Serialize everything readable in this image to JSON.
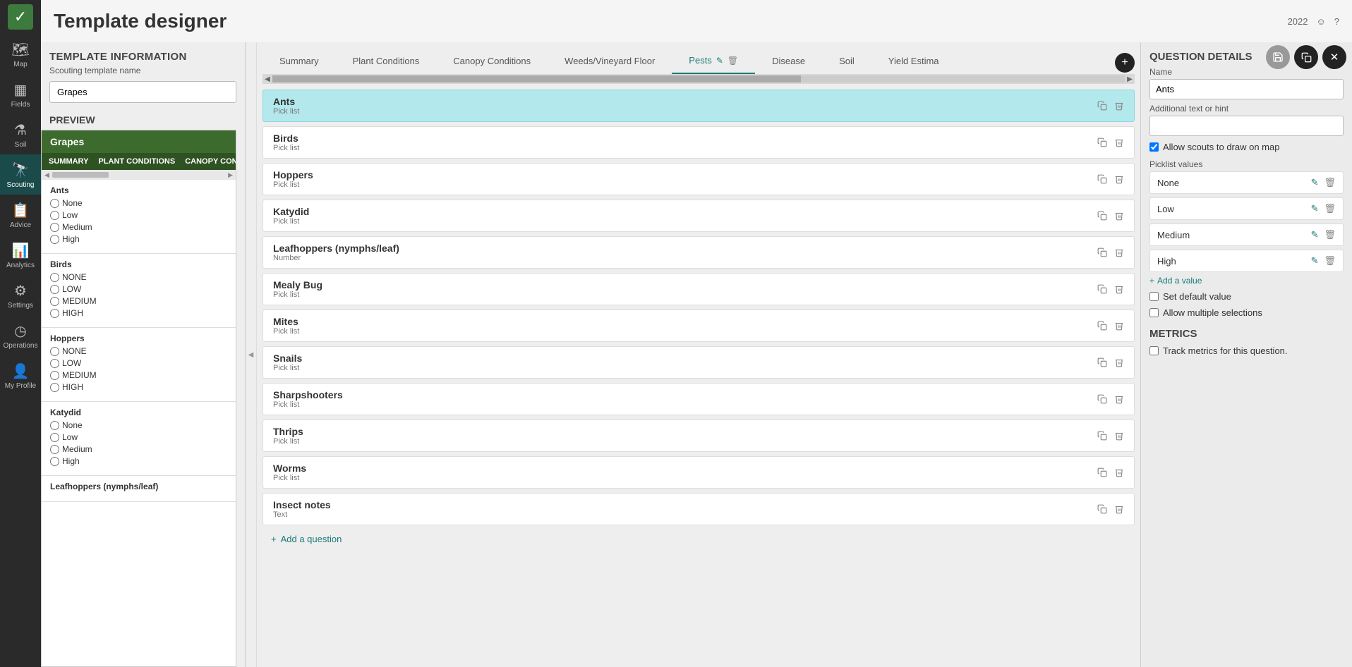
{
  "header": {
    "title": "Template designer",
    "year": "2022"
  },
  "nav": {
    "items": [
      {
        "label": "Map",
        "icon": "map"
      },
      {
        "label": "Fields",
        "icon": "fields"
      },
      {
        "label": "Soil",
        "icon": "flask"
      },
      {
        "label": "Scouting",
        "icon": "binoculars",
        "active": true
      },
      {
        "label": "Advice",
        "icon": "clipboard"
      },
      {
        "label": "Analytics",
        "icon": "chart"
      },
      {
        "label": "Settings",
        "icon": "gear"
      },
      {
        "label": "Operations",
        "icon": "gauge"
      },
      {
        "label": "My Profile",
        "icon": "user"
      }
    ]
  },
  "templateInfo": {
    "heading": "TEMPLATE INFORMATION",
    "nameLabel": "Scouting template name",
    "nameValue": "Grapes",
    "previewHeading": "PREVIEW"
  },
  "preview": {
    "title": "Grapes",
    "tabs": [
      "SUMMARY",
      "PLANT CONDITIONS",
      "CANOPY CON"
    ],
    "questions": [
      {
        "title": "Ants",
        "options": [
          "None",
          "Low",
          "Medium",
          "High"
        ]
      },
      {
        "title": "Birds",
        "options": [
          "NONE",
          "LOW",
          "MEDIUM",
          "HIGH"
        ]
      },
      {
        "title": "Hoppers",
        "options": [
          "NONE",
          "LOW",
          "MEDIUM",
          "HIGH"
        ]
      },
      {
        "title": "Katydid",
        "options": [
          "None",
          "Low",
          "Medium",
          "High"
        ]
      },
      {
        "title": "Leafhoppers (nymphs/leaf)",
        "options": []
      }
    ]
  },
  "centerTabs": {
    "tabs": [
      {
        "label": "Summary"
      },
      {
        "label": "Plant Conditions"
      },
      {
        "label": "Canopy Conditions"
      },
      {
        "label": "Weeds/Vineyard Floor"
      },
      {
        "label": "Pests",
        "active": true
      },
      {
        "label": "Disease"
      },
      {
        "label": "Soil"
      },
      {
        "label": "Yield Estima"
      }
    ]
  },
  "questions": [
    {
      "title": "Ants",
      "type": "Pick list",
      "selected": true
    },
    {
      "title": "Birds",
      "type": "Pick list"
    },
    {
      "title": "Hoppers",
      "type": "Pick list"
    },
    {
      "title": "Katydid",
      "type": "Pick list"
    },
    {
      "title": "Leafhoppers (nymphs/leaf)",
      "type": "Number"
    },
    {
      "title": "Mealy Bug",
      "type": "Pick list"
    },
    {
      "title": "Mites",
      "type": "Pick list"
    },
    {
      "title": "Snails",
      "type": "Pick list"
    },
    {
      "title": "Sharpshooters",
      "type": "Pick list"
    },
    {
      "title": "Thrips",
      "type": "Pick list"
    },
    {
      "title": "Worms",
      "type": "Pick list"
    },
    {
      "title": "Insect notes",
      "type": "Text"
    }
  ],
  "addQuestionLabel": "Add a question",
  "details": {
    "heading": "QUESTION DETAILS",
    "nameLabel": "Name",
    "nameValue": "Ants",
    "hintLabel": "Additional text or hint",
    "hintValue": "",
    "allowDrawLabel": "Allow scouts to draw on map",
    "allowDrawChecked": true,
    "picklistLabel": "Picklist values",
    "picklist": [
      "None",
      "Low",
      "Medium",
      "High"
    ],
    "addValueLabel": "Add a value",
    "setDefaultLabel": "Set default value",
    "setDefaultChecked": false,
    "allowMultipleLabel": "Allow multiple selections",
    "allowMultipleChecked": false,
    "metricsHeading": "METRICS",
    "trackMetricsLabel": "Track metrics for this question.",
    "trackMetricsChecked": false
  }
}
